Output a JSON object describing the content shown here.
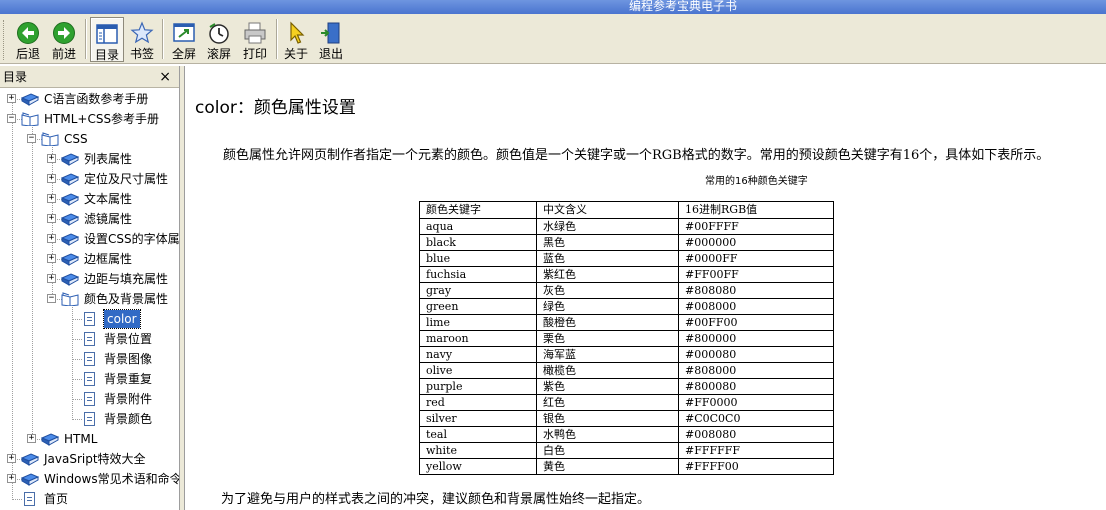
{
  "window": {
    "title": "编程参考宝典电子书"
  },
  "toolbar": {
    "buttons": [
      {
        "id": "back",
        "label": "后退",
        "icon": "back-arrow-icon"
      },
      {
        "id": "forward",
        "label": "前进",
        "icon": "forward-arrow-icon"
      },
      {
        "id": "toc",
        "label": "目录",
        "icon": "toc-panel-icon"
      },
      {
        "id": "bookmark",
        "label": "书签",
        "icon": "star-icon"
      },
      {
        "id": "fullscreen",
        "label": "全屏",
        "icon": "fullscreen-icon"
      },
      {
        "id": "scroll",
        "label": "滚屏",
        "icon": "clock-icon"
      },
      {
        "id": "print",
        "label": "打印",
        "icon": "printer-icon"
      },
      {
        "id": "about",
        "label": "关于",
        "icon": "pointer-icon"
      },
      {
        "id": "exit",
        "label": "退出",
        "icon": "exit-door-icon"
      }
    ]
  },
  "sidebar": {
    "title": "目录",
    "close_glyph": "×",
    "tree": [
      {
        "label": "C语言函数参考手册",
        "type": "book",
        "expanded": false
      },
      {
        "label": "HTML+CSS参考手册",
        "type": "book",
        "expanded": true
      },
      {
        "label": "CSS",
        "type": "book",
        "expanded": true
      },
      {
        "label": "列表属性",
        "type": "book",
        "expanded": false
      },
      {
        "label": "定位及尺寸属性",
        "type": "book",
        "expanded": false
      },
      {
        "label": "文本属性",
        "type": "book",
        "expanded": false
      },
      {
        "label": "滤镜属性",
        "type": "book",
        "expanded": false
      },
      {
        "label": "设置CSS的字体属",
        "type": "book",
        "expanded": false
      },
      {
        "label": "边框属性",
        "type": "book",
        "expanded": false
      },
      {
        "label": "边距与填充属性",
        "type": "book",
        "expanded": false
      },
      {
        "label": "颜色及背景属性",
        "type": "book",
        "expanded": true
      },
      {
        "label": "color",
        "type": "page",
        "selected": true
      },
      {
        "label": "背景位置",
        "type": "page"
      },
      {
        "label": "背景图像",
        "type": "page"
      },
      {
        "label": "背景重复",
        "type": "page"
      },
      {
        "label": "背景附件",
        "type": "page"
      },
      {
        "label": "背景颜色",
        "type": "page"
      },
      {
        "label": "HTML",
        "type": "book",
        "expanded": false
      },
      {
        "label": "JavaSript特效大全",
        "type": "book",
        "expanded": false
      },
      {
        "label": "Windows常见术语和命令",
        "type": "book",
        "expanded": false
      },
      {
        "label": "首页",
        "type": "page"
      }
    ]
  },
  "content": {
    "title": "color：颜色属性设置",
    "intro": "颜色属性允许网页制作者指定一个元素的颜色。颜色值是一个关键字或一个RGB格式的数字。常用的预设颜色关键字有16个，具体如下表所示。",
    "table_caption": "常用的16种颜色关键字",
    "table": {
      "headers": [
        "颜色关键字",
        "中文含义",
        "16进制RGB值"
      ],
      "rows": [
        [
          "aqua",
          "水绿色",
          "#00FFFF"
        ],
        [
          "black",
          "黑色",
          "#000000"
        ],
        [
          "blue",
          "蓝色",
          "#0000FF"
        ],
        [
          "fuchsia",
          "紫红色",
          "#FF00FF"
        ],
        [
          "gray",
          "灰色",
          "#808080"
        ],
        [
          "green",
          "绿色",
          "#008000"
        ],
        [
          "lime",
          "酸橙色",
          "#00FF00"
        ],
        [
          "maroon",
          "栗色",
          "#800000"
        ],
        [
          "navy",
          "海军蓝",
          "#000080"
        ],
        [
          "olive",
          "橄榄色",
          "#808000"
        ],
        [
          "purple",
          "紫色",
          "#800080"
        ],
        [
          "red",
          "红色",
          "#FF0000"
        ],
        [
          "silver",
          "银色",
          "#C0C0C0"
        ],
        [
          "teal",
          "水鸭色",
          "#008080"
        ],
        [
          "white",
          "白色",
          "#FFFFFF"
        ],
        [
          "yellow",
          "黄色",
          "#FFFF00"
        ]
      ]
    },
    "footer": "为了避免与用户的样式表之间的冲突，建议颜色和背景属性始终一起指定。"
  },
  "colors": {
    "titlebar": "#5a82d6",
    "toolbar_bg": "#ece9d8",
    "selection": "#316ac5"
  }
}
